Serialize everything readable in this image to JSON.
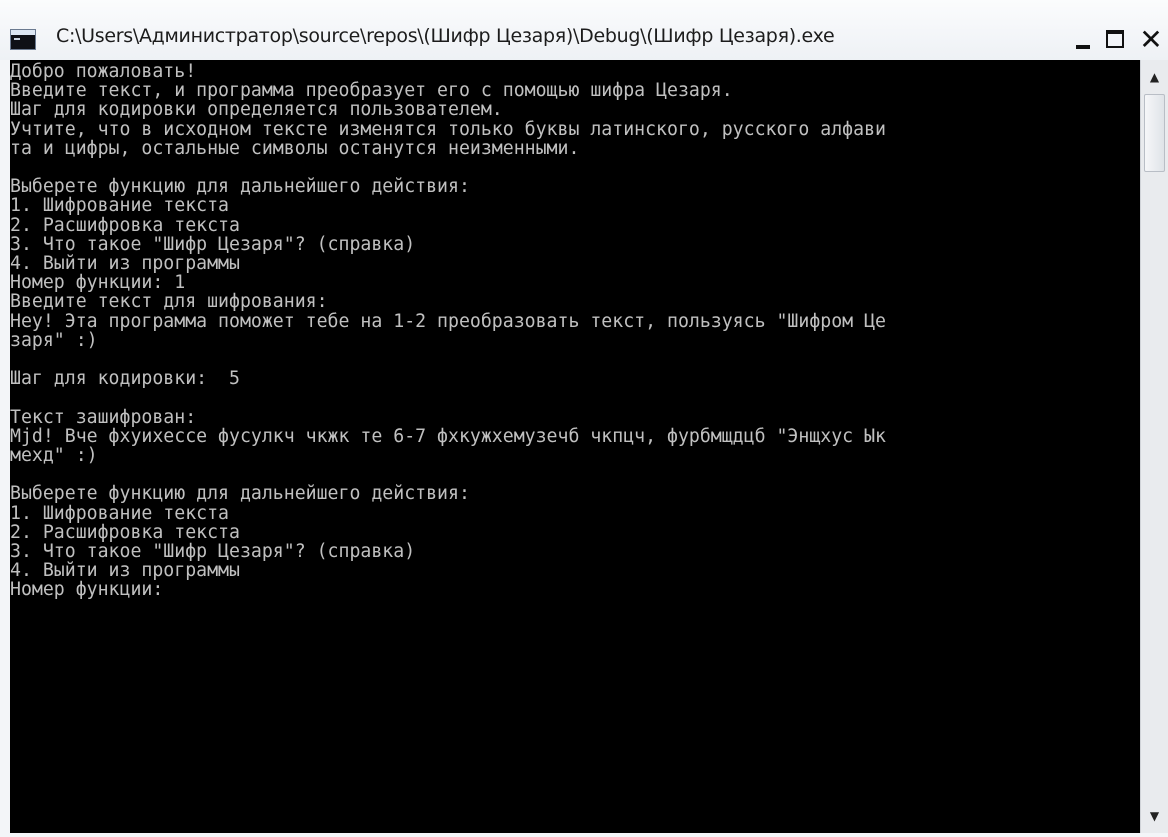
{
  "window": {
    "title": "C:\\Users\\Администратор\\source\\repos\\(Шифр Цезаря)\\Debug\\(Шифр Цезаря).exe",
    "close_glyph": "✕"
  },
  "console": {
    "lines": [
      "Добро пожаловать!",
      "Введите текст, и программа преобразует его с помощью шифра Цезаря.",
      "Шаг для кодировки определяется пользователем.",
      "Учтите, что в исходном тексте изменятся только буквы латинского, русского алфави",
      "та и цифры, остальные символы останутся неизменными.",
      "",
      "Выберете функцию для дальнейшего действия:",
      "1. Шифрование текста",
      "2. Расшифровка текста",
      "3. Что такое \"Шифр Цезаря\"? (справка)",
      "4. Выйти из программы",
      "Номер функции: 1",
      "Введите текст для шифрования:",
      "Hey! Эта программа поможет тебе на 1-2 преобразовать текст, пользуясь \"Шифром Це",
      "заря\" :)",
      "",
      "Шаг для кодировки:  5",
      "",
      "Текст зашифрован:",
      "Mjd! Вче фхуихессе фусулкч чкжк те 6-7 фхкужхемузечб чкпцч, фурбмщдцб \"Энщхус Ык",
      "мехд\" :)",
      "",
      "Выберете функцию для дальнейшего действия:",
      "1. Шифрование текста",
      "2. Расшифровка текста",
      "3. Что такое \"Шифр Цезаря\"? (справка)",
      "4. Выйти из программы",
      "Номер функции:"
    ]
  },
  "scrollbar": {
    "up_glyph": "▲",
    "down_glyph": "▼"
  }
}
